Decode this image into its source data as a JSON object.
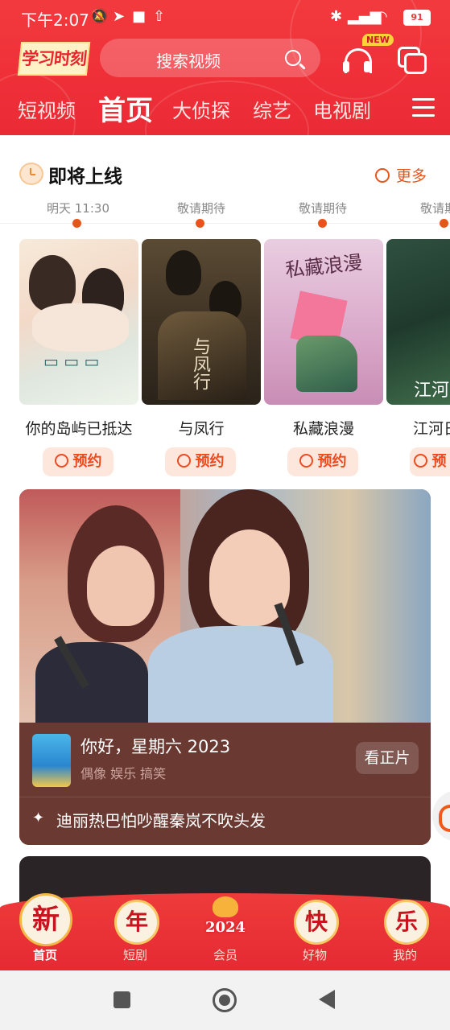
{
  "status_bar": {
    "time": "下午2:07",
    "battery": "91"
  },
  "header": {
    "logo_text": "学习时刻",
    "search_placeholder": "搜索视频",
    "new_badge": "NEW",
    "nav_tabs": [
      "短视频",
      "首页",
      "大侦探",
      "综艺",
      "电视剧"
    ],
    "active_tab": "首页"
  },
  "upcoming": {
    "title": "即将上线",
    "more_label": "更多",
    "schedule": [
      "明天 11:30",
      "敬请期待",
      "敬请期待",
      "敬请期待"
    ],
    "items": [
      {
        "name": "你的岛屿已抵达",
        "button": "预约"
      },
      {
        "name": "与凤行",
        "button": "预约"
      },
      {
        "name": "私藏浪漫",
        "button": "预约"
      },
      {
        "name": "江河日",
        "button": "预"
      }
    ]
  },
  "feature": {
    "show_title": "你好，星期六 2023",
    "tags": "偶像 娱乐 搞笑",
    "watch_label": "看正片",
    "headline": "迪丽热巴怕吵醒秦岚不吹头发"
  },
  "tab_bar": {
    "items": [
      {
        "glyph": "新",
        "label": "首页"
      },
      {
        "glyph": "年",
        "label": "短剧"
      },
      {
        "glyph": "2024",
        "label": "会员"
      },
      {
        "glyph": "快",
        "label": "好物"
      },
      {
        "glyph": "乐",
        "label": "我的"
      }
    ],
    "active_label": "首页"
  },
  "colors": {
    "brand_red": "#ef2f38",
    "accent_orange": "#e8551a",
    "card_brown": "#6a3a32"
  }
}
